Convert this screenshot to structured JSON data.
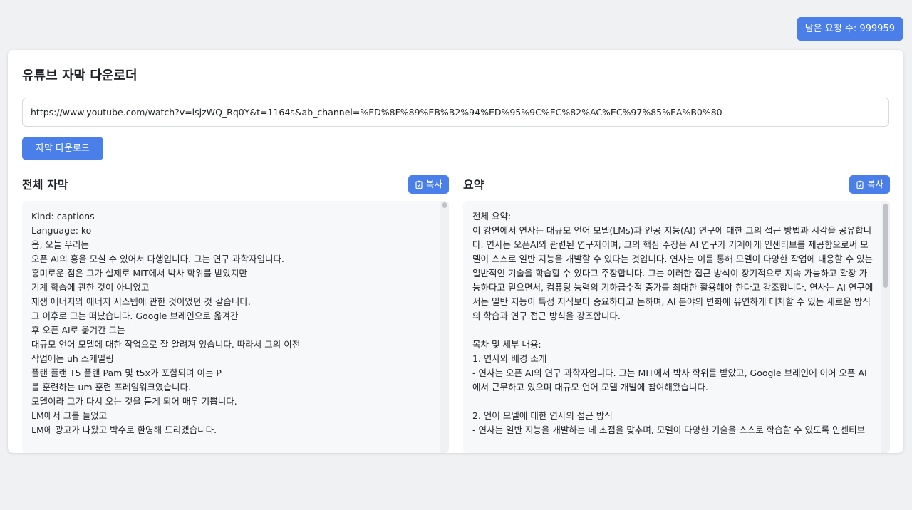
{
  "quota": {
    "label": "남은 요청 수: 999959"
  },
  "page": {
    "title": "유튜브 자막 다운로더"
  },
  "url_input": {
    "value": "https://www.youtube.com/watch?v=lsjzWQ_Rq0Y&t=1164s&ab_channel=%ED%8F%89%EB%B2%94%ED%95%9C%EC%82%AC%EC%97%85%EA%B0%80",
    "placeholder": ""
  },
  "download_button": {
    "label": "자막 다운로드"
  },
  "transcript": {
    "title": "전체 자막",
    "copy_label": "복사",
    "copy_icon": "clipboard-icon",
    "lines": [
      "Kind: captions",
      "Language: ko",
      "음, 오늘 우리는",
      "오픈 AI의 홍을 모실 수 있어서 다행입니다. 그는 연구 과학자입니다.",
      "흥미로운 점은 그가 실제로 MIT에서 박사 학위를 받았지만",
      "기계 학습에 관한 것이 아니었고",
      "재생 에너지와 에너지 시스템에 관한 것이었던 것 같습니다.",
      "그 이후로 그는 떠났습니다. Google 브레인으로 옮겨간",
      "후 오픈 AI로 옮겨간 그는",
      "대규모 언어 모델에 대한 작업으로 잘 알려져 있습니다. 따라서 그의 이전",
      "작업에는 uh 스케일링",
      "플랜 플랜 T5 플랜 Pam 및 t5x가 포함되며 이는 P",
      "를 훈련하는 um 훈련 프레임워크였습니다.",
      "모델이라 그가 다시 오는 것을 듣게 되어 매우 기쁩니다.",
      "LM에서 그를 들었고",
      "LM에 광고가 나왔고 박수로 환영해 드리겠습니다."
    ]
  },
  "summary": {
    "title": "요약",
    "copy_label": "복사",
    "copy_icon": "clipboard-icon",
    "overall_heading": "전체 요약:",
    "overall_text": "이 강연에서 연사는 대규모 언어 모델(LMs)과 인공 지능(AI) 연구에 대한 그의 접근 방법과 시각을 공유합니다. 연사는 오픈AI와 관련된 연구자이며, 그의 핵심 주장은 AI 연구가 기계에게 인센티브를 제공함으로써 모델이 스스로 일반 지능을 개발할 수 있다는 것입니다. 연사는 이를 통해 모델이 다양한 작업에 대응할 수 있는 일반적인 기술을 학습할 수 있다고 주장합니다. 그는 이러한 접근 방식이 장기적으로 지속 가능하고 확장 가능하다고 믿으면서, 컴퓨팅 능력의 기하급수적 증가를 최대한 활용해야 한다고 강조합니다. 연사는 AI 연구에서는 일반 지능이 특정 지식보다 중요하다고 논하며, AI 분야의 변화에 유연하게 대처할 수 있는 새로운 방식의 학습과 연구 접근 방식을 강조합니다.",
    "toc_heading": "목차 및 세부 내용:",
    "s1_heading": "1. 연사와 배경 소개",
    "s1_text": "- 연사는 오픈 AI의 연구 과학자입니다. 그는 MIT에서 박사 학위를 받았고, Google 브레인에 이어 오픈 AI에서 근무하고 있으며 대규모 언어 모델 개발에 참여해왔습니다.",
    "s2_heading": "2. 언어 모델에 대한 연사의 접근 방식",
    "s2_text": "- 연사는 일반 지능을 개발하는 데 초점을 맞추며, 모델이 다양한 기술을 스스로 학습할 수 있도록 인센티브"
  },
  "colors": {
    "accent": "#4a7fea",
    "background": "#f0f1f3",
    "panel": "#f7f8f9"
  }
}
